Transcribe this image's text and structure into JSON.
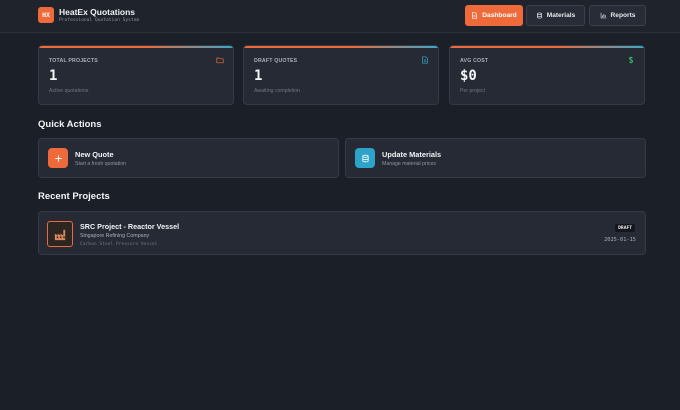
{
  "app": {
    "logo": "HX",
    "title": "HeatEx Quotations",
    "subtitle": "Professional Quotation System"
  },
  "nav": {
    "dashboard": "Dashboard",
    "materials": "Materials",
    "reports": "Reports",
    "active": "dashboard"
  },
  "stats": [
    {
      "label": "TOTAL PROJECTS",
      "value": "1",
      "hint": "Active quotations",
      "icon": "folder-icon"
    },
    {
      "label": "DRAFT QUOTES",
      "value": "1",
      "hint": "Awaiting completion",
      "icon": "document-icon"
    },
    {
      "label": "AVG COST",
      "value": "$0",
      "hint": "Per project",
      "icon": "dollar-icon"
    }
  ],
  "quick_actions": {
    "title": "Quick Actions",
    "items": [
      {
        "title": "New Quote",
        "subtitle": "Start a fresh quotation",
        "icon": "plus-icon",
        "color": "#ef6a3a"
      },
      {
        "title": "Update Materials",
        "subtitle": "Manage material prices",
        "icon": "database-icon",
        "color": "#2ea3c9"
      }
    ]
  },
  "recent": {
    "title": "Recent Projects",
    "items": [
      {
        "title": "SRC Project - Reactor Vessel",
        "client": "Singapore Refining Company",
        "type": "Carbon Steel Pressure Vessel",
        "status": "DRAFT",
        "date": "2025-01-15",
        "icon": "factory-icon"
      }
    ]
  },
  "colors": {
    "accent": "#ef6a3a",
    "secondary": "#2ea3c9",
    "background": "#1b1f27",
    "card": "#252a34",
    "success": "#3fbf6f"
  }
}
